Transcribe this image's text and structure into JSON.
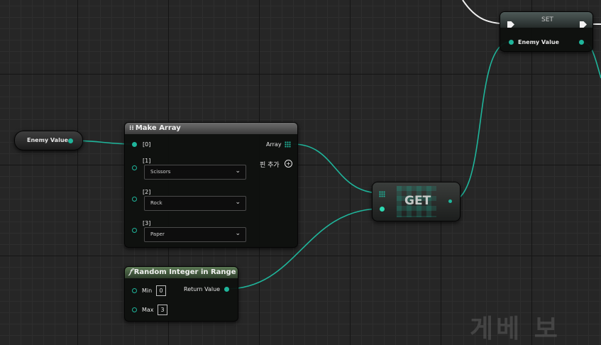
{
  "nodes": {
    "enemy_value_getter": {
      "label": "Enemy Value"
    },
    "set": {
      "title": "SET",
      "pin_label": "Enemy Value"
    },
    "make_array": {
      "title": "Make Array",
      "output_label": "Array",
      "add_pin_label": "핀 추가",
      "inputs": [
        {
          "index": "[0]"
        },
        {
          "index": "[1]",
          "value": "Scissors"
        },
        {
          "index": "[2]",
          "value": "Rock"
        },
        {
          "index": "[3]",
          "value": "Paper"
        }
      ]
    },
    "get": {
      "title": "GET"
    },
    "random_integer": {
      "title": "Random Integer in Range",
      "return_label": "Return Value",
      "min_label": "Min",
      "min_value": "0",
      "max_label": "Max",
      "max_value": "3"
    }
  },
  "watermark": "게베 보",
  "colors": {
    "pin": "#1fb59b",
    "wire": "#1fb59b",
    "exec": "#f2f2f2",
    "function_header": "#4e6b48"
  },
  "icons": {
    "make_array": "make-array-icon",
    "function": "function-icon",
    "add_pin": "add-pin-icon",
    "dropdown": "chevron-down-icon"
  }
}
